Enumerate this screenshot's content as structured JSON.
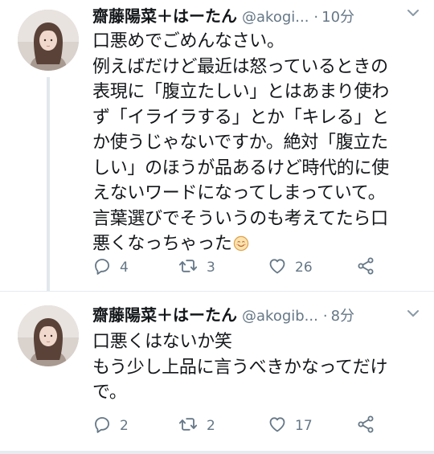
{
  "tweets": [
    {
      "display_name": "齋藤陽菜＋はーたん",
      "handle": "@akogi...",
      "separator": "·",
      "time": "10分",
      "body_lines": [
        "口悪めでごめんなさい。",
        "例えばだけど最近は怒っているときの",
        "表現に「腹立たしい」とはあまり使わ",
        "ず「イライラする」とか「キレる」と",
        "か使うじゃないですか。絶対「腹立た",
        "しい」のほうが品あるけど時代的に使",
        "えないワードになってしまっていて。",
        "言葉選びでそういうのも考えてたら口",
        "悪くなっちゃった"
      ],
      "emoji": "smiling-face-emoji",
      "reply_count": "4",
      "retweet_count": "3",
      "like_count": "26"
    },
    {
      "display_name": "齋藤陽菜＋はーたん",
      "handle": "@akogib...",
      "separator": "·",
      "time": "8分",
      "body_lines": [
        "口悪くはないか笑",
        "もう少し上品に言うべきかなってだけ",
        "で。"
      ],
      "reply_count": "2",
      "retweet_count": "2",
      "like_count": "17"
    }
  ],
  "colors": {
    "text": "#14171a",
    "secondary": "#657786",
    "divider": "#e6ecf0",
    "thread_line": "#e1e8ed"
  },
  "icons": [
    "reply-icon",
    "retweet-icon",
    "like-icon",
    "share-icon",
    "caret-down-icon",
    "avatar"
  ]
}
